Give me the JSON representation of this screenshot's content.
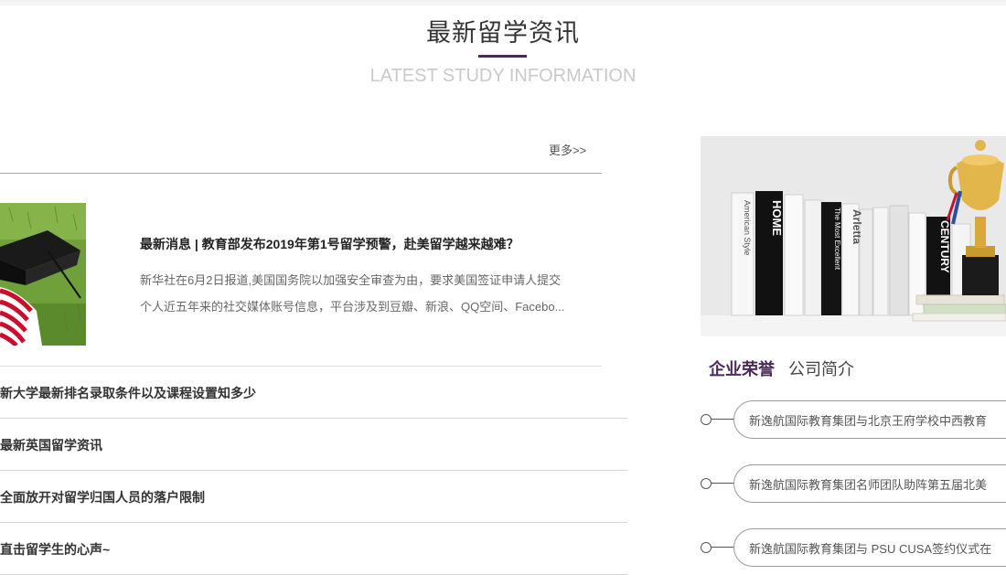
{
  "section": {
    "title": "最新留学资讯",
    "subtitle": "LATEST STUDY INFORMATION",
    "accent_color": "#4b2a5a"
  },
  "news": {
    "more_label": "更多>>",
    "featured": {
      "title": "最新消息 | 教育部发布2019年第1号留学预警，赴美留学越来越难？",
      "desc_line1": "新华社在6月2日报道,美国国务院以加强安全审查为由，要求美国签证申请人提交",
      "desc_line2": "个人近五年来的社交媒体账号信息，平台涉及到豆瓣、新浪、QQ空间、Facebo..."
    },
    "items": [
      {
        "title": "新大学最新排名录取条件以及课程设置知多少"
      },
      {
        "title": "最新英国留学资讯"
      },
      {
        "title": "全面放开对留学归国人员的落户限制"
      },
      {
        "title": "直击留学生的心声~"
      }
    ]
  },
  "sidebar": {
    "tabs": [
      {
        "label": "企业荣誉"
      },
      {
        "label": "公司简介"
      }
    ],
    "honors": [
      {
        "text": "新逸航国际教育集团与北京王府学校中西教育"
      },
      {
        "text": "新逸航国际教育集团名师团队助阵第五届北美"
      },
      {
        "text": "新逸航国际教育集团与 PSU CUSA签约仪式在"
      }
    ]
  }
}
